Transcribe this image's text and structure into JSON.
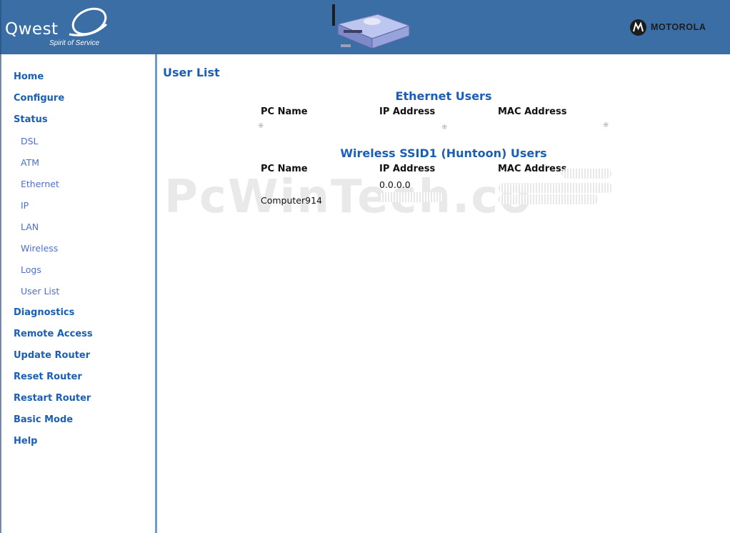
{
  "header": {
    "brand": "Qwest",
    "tagline": "Spirit of Service",
    "manufacturer": "MOTOROLA"
  },
  "sidebar": {
    "items": [
      {
        "label": "Home",
        "level": 0
      },
      {
        "label": "Configure",
        "level": 0
      },
      {
        "label": "Status",
        "level": 0
      },
      {
        "label": "DSL",
        "level": 1
      },
      {
        "label": "ATM",
        "level": 1
      },
      {
        "label": "Ethernet",
        "level": 1
      },
      {
        "label": "IP",
        "level": 1
      },
      {
        "label": "LAN",
        "level": 1
      },
      {
        "label": "Wireless",
        "level": 1
      },
      {
        "label": "Logs",
        "level": 1
      },
      {
        "label": "User List",
        "level": 1
      },
      {
        "label": "Diagnostics",
        "level": 0
      },
      {
        "label": "Remote Access",
        "level": 0
      },
      {
        "label": "Update Router",
        "level": 0
      },
      {
        "label": "Reset Router",
        "level": 0
      },
      {
        "label": "Restart Router",
        "level": 0
      },
      {
        "label": "Basic Mode",
        "level": 0
      },
      {
        "label": "Help",
        "level": 0
      }
    ]
  },
  "main": {
    "title": "User List",
    "ethernet": {
      "title": "Ethernet Users",
      "columns": [
        "PC Name",
        "IP Address",
        "MAC Address"
      ]
    },
    "wireless": {
      "title": "Wireless SSID1 (Huntoon) Users",
      "columns": [
        "PC Name",
        "IP Address",
        "MAC Address"
      ],
      "rows": [
        {
          "pc_name": "",
          "ip": "0.0.0.0",
          "mac": ""
        },
        {
          "pc_name": "Computer914",
          "ip": "",
          "mac": ""
        }
      ]
    },
    "watermark": "PcWinTech.co"
  },
  "colors": {
    "header_bg": "#3a6ea5",
    "link": "#1a5fb4",
    "sublink": "#4d6fc9",
    "sidebar_border": "#6d9ccc"
  }
}
